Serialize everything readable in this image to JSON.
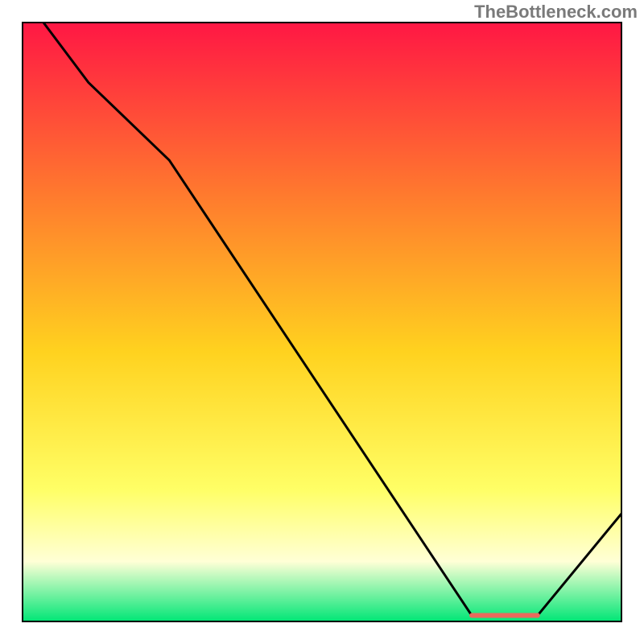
{
  "watermark": "TheBottleneck.com",
  "chart_data": {
    "type": "line",
    "title": "",
    "xlabel": "",
    "ylabel": "",
    "xlim": [
      0,
      100
    ],
    "ylim": [
      0,
      100
    ],
    "background_gradient": {
      "top_color": "#ff1744",
      "upper_mid_color": "#ff7e2d",
      "mid_color": "#ffd21f",
      "lower_mid_color": "#ffff66",
      "pale_band_color": "#ffffd6",
      "bottom_color": "#00e676"
    },
    "curve": {
      "x": [
        3.5,
        11.0,
        24.5,
        75.0,
        86.0,
        100.0
      ],
      "y": [
        100.0,
        90.0,
        77.0,
        1.0,
        1.0,
        18.0
      ]
    },
    "flat_segment_marker": {
      "x_start": 75.0,
      "x_end": 86.0,
      "y": 1.0,
      "color": "#e96a5c",
      "thickness": 6
    }
  }
}
